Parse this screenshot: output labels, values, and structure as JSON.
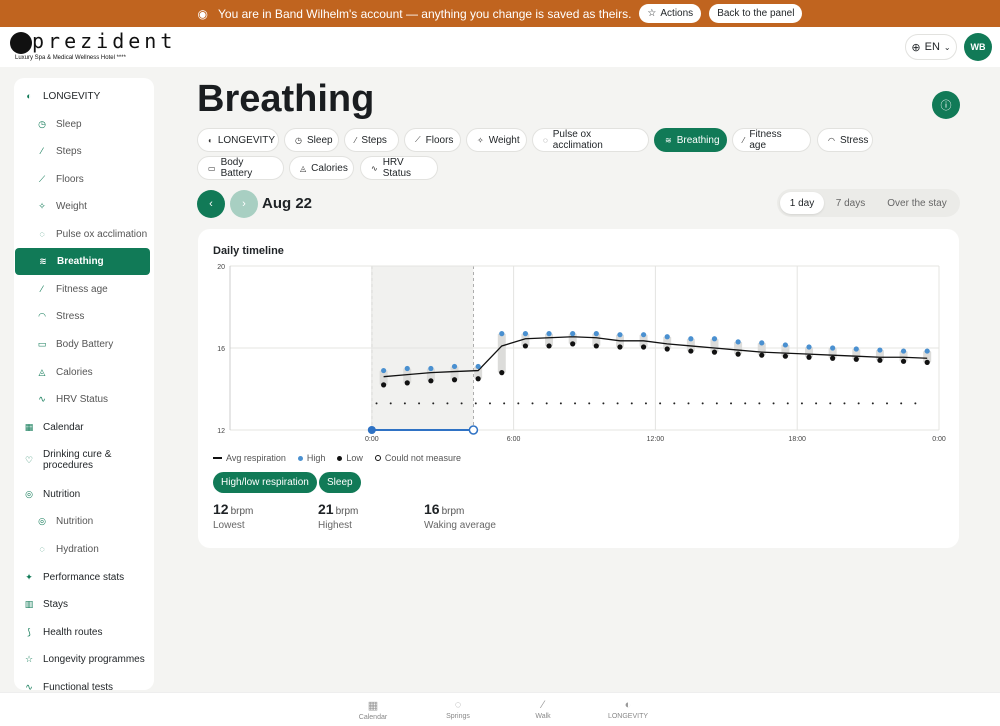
{
  "banner": {
    "message": "You are in Band Wilhelm's account — anything you change is saved as theirs.",
    "actions_label": "Actions",
    "back_label": "Back to the panel"
  },
  "header": {
    "logo_word": "prezident",
    "logo_tagline": "Luxury Spa & Medical Wellness Hotel ****",
    "language": "EN",
    "avatar_initials": "WB"
  },
  "sidebar": {
    "items": [
      {
        "label": "LONGEVITY",
        "level": "top",
        "icon": "longevity-icon",
        "glyph": "◐"
      },
      {
        "label": "Sleep",
        "level": "sub",
        "icon": "clock-icon",
        "glyph": "◷"
      },
      {
        "label": "Steps",
        "level": "sub",
        "icon": "walk-icon",
        "glyph": "⁄"
      },
      {
        "label": "Floors",
        "level": "sub",
        "icon": "stairs-icon",
        "glyph": "⟋"
      },
      {
        "label": "Weight",
        "level": "sub",
        "icon": "scale-icon",
        "glyph": "✧"
      },
      {
        "label": "Pulse ox acclimation",
        "level": "sub",
        "icon": "drop-icon",
        "glyph": "◌"
      },
      {
        "label": "Breathing",
        "level": "sub",
        "icon": "wind-icon",
        "glyph": "≋",
        "active": true
      },
      {
        "label": "Fitness age",
        "level": "sub",
        "icon": "run-icon",
        "glyph": "⁄"
      },
      {
        "label": "Stress",
        "level": "sub",
        "icon": "gauge-icon",
        "glyph": "◠"
      },
      {
        "label": "Body Battery",
        "level": "sub",
        "icon": "battery-icon",
        "glyph": "▭"
      },
      {
        "label": "Calories",
        "level": "sub",
        "icon": "flame-icon",
        "glyph": "◬"
      },
      {
        "label": "HRV Status",
        "level": "sub",
        "icon": "pulse-icon",
        "glyph": "∿"
      },
      {
        "label": "Calendar",
        "level": "top",
        "icon": "calendar-icon",
        "glyph": "▦"
      },
      {
        "label": "Drinking cure & procedures",
        "level": "top",
        "icon": "heart-icon",
        "glyph": "♡"
      },
      {
        "label": "Nutrition",
        "level": "top",
        "icon": "nutrition-icon",
        "glyph": "◎"
      },
      {
        "label": "Nutrition",
        "level": "sub",
        "icon": "nutrition-icon",
        "glyph": "◎"
      },
      {
        "label": "Hydration",
        "level": "sub",
        "icon": "drop-icon",
        "glyph": "◌"
      },
      {
        "label": "Performance stats",
        "level": "top",
        "icon": "sparkle-icon",
        "glyph": "✦"
      },
      {
        "label": "Stays",
        "level": "top",
        "icon": "building-icon",
        "glyph": "▥"
      },
      {
        "label": "Health routes",
        "level": "top",
        "icon": "route-icon",
        "glyph": "⟆"
      },
      {
        "label": "Longevity programmes",
        "level": "top",
        "icon": "star-icon",
        "glyph": "☆"
      },
      {
        "label": "Functional tests",
        "level": "top",
        "icon": "pulse-icon",
        "glyph": "∿"
      }
    ]
  },
  "page": {
    "title": "Breathing",
    "date": "Aug 22"
  },
  "tabs": [
    {
      "label": "LONGEVITY",
      "icon": "longevity-icon",
      "glyph": "◐"
    },
    {
      "label": "Sleep",
      "icon": "clock-icon",
      "glyph": "◷"
    },
    {
      "label": "Steps",
      "icon": "walk-icon",
      "glyph": "⁄"
    },
    {
      "label": "Floors",
      "icon": "stairs-icon",
      "glyph": "⟋"
    },
    {
      "label": "Weight",
      "icon": "scale-icon",
      "glyph": "✧"
    },
    {
      "label": "Pulse ox acclimation",
      "icon": "drop-icon",
      "glyph": "◌"
    },
    {
      "label": "Breathing",
      "icon": "wind-icon",
      "glyph": "≋",
      "active": true
    },
    {
      "label": "Fitness age",
      "icon": "run-icon",
      "glyph": "⁄"
    },
    {
      "label": "Stress",
      "icon": "gauge-icon",
      "glyph": "◠"
    },
    {
      "label": "Body Battery",
      "icon": "battery-icon",
      "glyph": "▭"
    },
    {
      "label": "Calories",
      "icon": "flame-icon",
      "glyph": "◬"
    },
    {
      "label": "HRV Status",
      "icon": "pulse-icon",
      "glyph": "∿"
    }
  ],
  "range": {
    "options": [
      "1 day",
      "7 days",
      "Over the stay"
    ],
    "selected": "1 day"
  },
  "card": {
    "title": "Daily timeline",
    "legend": {
      "avg": "Avg respiration",
      "high": "High",
      "low": "Low",
      "none": "Could not measure"
    },
    "filters": [
      "High/low respiration",
      "Sleep"
    ],
    "stats": [
      {
        "value": "12",
        "unit": "brpm",
        "label": "Lowest"
      },
      {
        "value": "21",
        "unit": "brpm",
        "label": "Highest"
      },
      {
        "value": "16",
        "unit": "brpm",
        "label": "Waking average"
      }
    ]
  },
  "colors": {
    "accent": "#117a57",
    "banner": "#c0641f",
    "high": "#4a90d0",
    "low": "#111111"
  },
  "chart_data": {
    "type": "line",
    "ylim": [
      12,
      20
    ],
    "xlim": [
      -6,
      24
    ],
    "y_ticks": [
      12,
      16,
      20
    ],
    "x_ticks": [
      0,
      6,
      12,
      18,
      24
    ],
    "x_tick_labels": [
      "0:00",
      "6:00",
      "12:00",
      "18:00",
      "0:00"
    ],
    "sleep_window": [
      0,
      4.3
    ],
    "grid": true,
    "legend": "bottom-left",
    "series": [
      {
        "name": "Avg respiration",
        "x": [
          0.5,
          1.5,
          2.5,
          3.5,
          4.5,
          5.5,
          6.5,
          7.5,
          8.5,
          9.5,
          10.5,
          11.5,
          12.5,
          13.5,
          14.5,
          15.5,
          16.5,
          17.5,
          18.5,
          19.5,
          20.5,
          21.5,
          22.5,
          23.5
        ],
        "values": [
          14.6,
          14.7,
          14.8,
          14.85,
          14.9,
          16.1,
          16.45,
          16.5,
          16.55,
          16.5,
          16.35,
          16.35,
          16.2,
          16.1,
          16.0,
          15.9,
          15.8,
          15.75,
          15.7,
          15.65,
          15.6,
          15.55,
          15.55,
          15.5
        ]
      },
      {
        "name": "High",
        "x": [
          0.5,
          1.5,
          2.5,
          3.5,
          4.5,
          5.5,
          6.5,
          7.5,
          8.5,
          9.5,
          10.5,
          11.5,
          12.5,
          13.5,
          14.5,
          15.5,
          16.5,
          17.5,
          18.5,
          19.5,
          20.5,
          21.5,
          22.5,
          23.5
        ],
        "values": [
          14.9,
          15.0,
          15.0,
          15.1,
          15.1,
          16.7,
          16.7,
          16.7,
          16.7,
          16.7,
          16.65,
          16.65,
          16.55,
          16.45,
          16.45,
          16.3,
          16.25,
          16.15,
          16.05,
          16.0,
          15.95,
          15.9,
          15.85,
          15.85
        ]
      },
      {
        "name": "Low",
        "x": [
          0.5,
          1.5,
          2.5,
          3.5,
          4.5,
          5.5,
          6.5,
          7.5,
          8.5,
          9.5,
          10.5,
          11.5,
          12.5,
          13.5,
          14.5,
          15.5,
          16.5,
          17.5,
          18.5,
          19.5,
          20.5,
          21.5,
          22.5,
          23.5
        ],
        "values": [
          14.2,
          14.3,
          14.4,
          14.45,
          14.5,
          14.8,
          16.1,
          16.1,
          16.2,
          16.1,
          16.05,
          16.05,
          15.95,
          15.85,
          15.8,
          15.7,
          15.65,
          15.6,
          15.55,
          15.5,
          15.45,
          15.4,
          15.35,
          15.3
        ]
      }
    ]
  },
  "bottom_nav": [
    {
      "label": "Calendar",
      "icon": "calendar-icon",
      "glyph": "▦"
    },
    {
      "label": "Springs",
      "icon": "drop-icon",
      "glyph": "◌"
    },
    {
      "label": "Walk",
      "icon": "walk-icon",
      "glyph": "⁄"
    },
    {
      "label": "LONGEVITY",
      "icon": "longevity-icon",
      "glyph": "◐"
    }
  ]
}
